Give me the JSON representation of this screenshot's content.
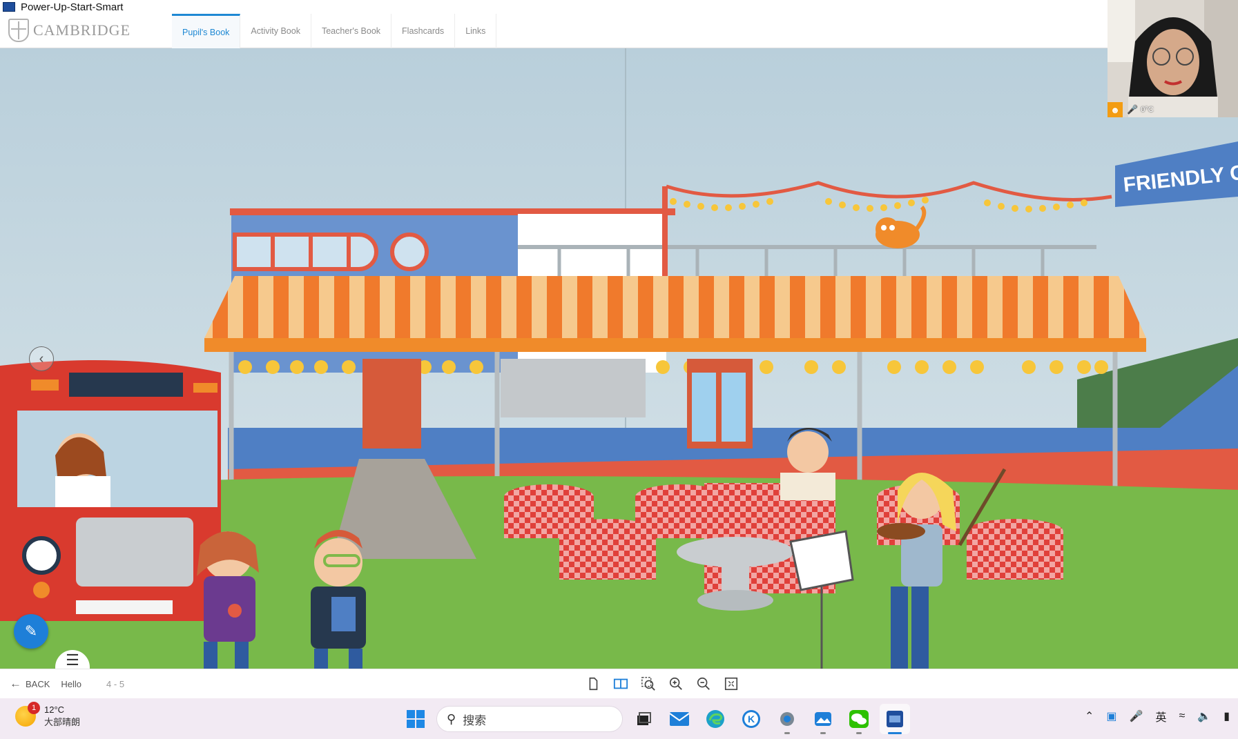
{
  "window": {
    "title": "Power-Up-Start-Smart"
  },
  "header": {
    "logo_text": "CAMBRIDGE",
    "tabs": [
      {
        "label": "Pupil's Book",
        "active": true
      },
      {
        "label": "Activity Book",
        "active": false
      },
      {
        "label": "Teacher's Book",
        "active": false
      },
      {
        "label": "Flashcards",
        "active": false
      },
      {
        "label": "Links",
        "active": false
      }
    ]
  },
  "scene": {
    "cafe_sign": "FRIENDLY CAFÉ",
    "colors": {
      "sky": "#c9dbe4",
      "grass": "#78b94a",
      "awning_orange": "#f07a2c",
      "awning_cream": "#f6c98d",
      "bus_red": "#d93a2e",
      "wall_blue": "#4f7fc4"
    }
  },
  "webcam": {
    "temperature": "0°C"
  },
  "toolbar": {
    "back_label": "BACK",
    "unit_label": "Hello",
    "pages": "4 - 5",
    "tools": [
      "single-page-icon",
      "double-page-icon",
      "zoom-area-icon",
      "zoom-in-icon",
      "zoom-out-icon",
      "fit-screen-icon"
    ]
  },
  "taskbar": {
    "weather": {
      "temperature": "12°C",
      "condition": "大部晴朗",
      "notifications": "1"
    },
    "search_placeholder": "搜索",
    "tray_language": "英"
  }
}
